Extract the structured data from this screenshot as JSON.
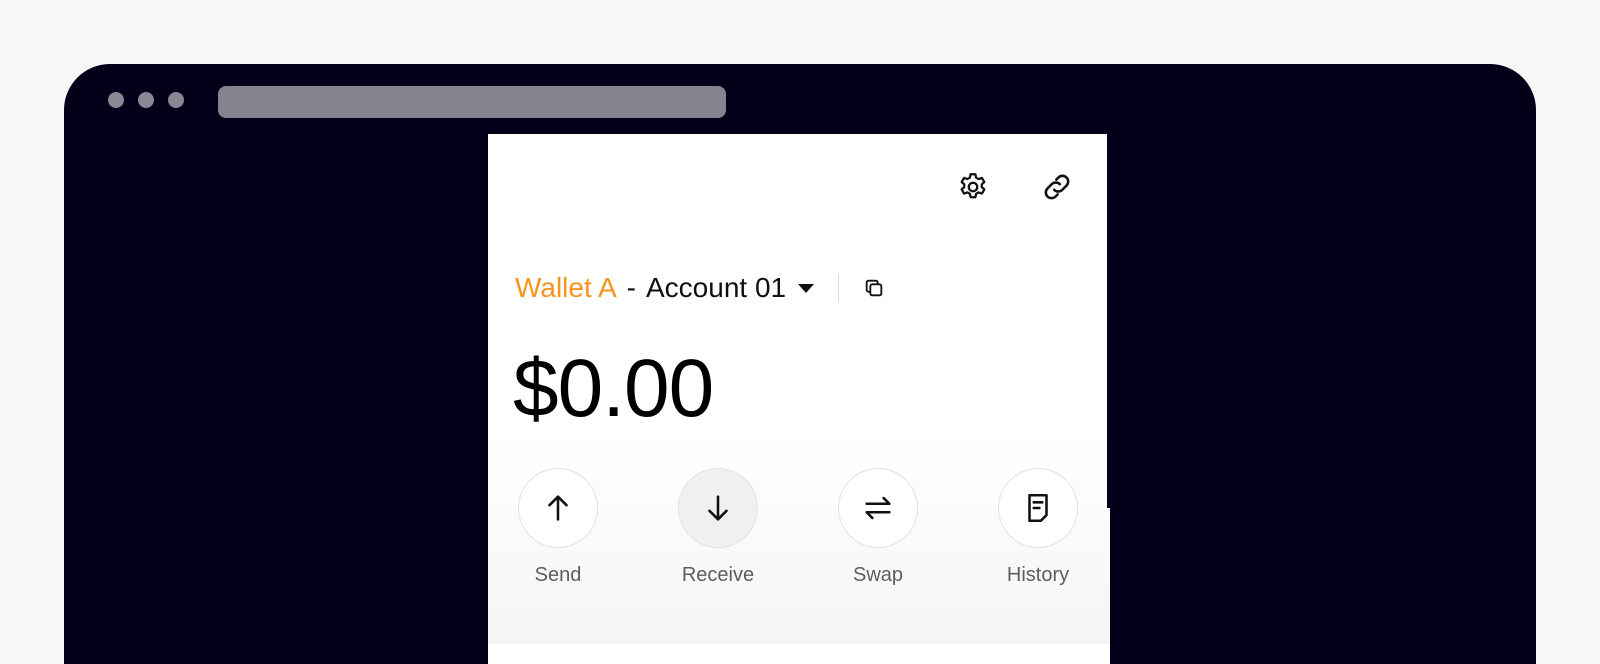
{
  "colors": {
    "background": "#f7f7f7",
    "window": "#050019",
    "accent": "#f7941d"
  },
  "header": {
    "icons": [
      "gear-icon",
      "link-icon"
    ]
  },
  "account": {
    "wallet_name": "Wallet A",
    "separator": "-",
    "account_name": "Account 01",
    "icons": [
      "chevron-down-icon",
      "copy-icon"
    ]
  },
  "balance": {
    "value": "$0.00"
  },
  "actions": [
    {
      "label": "Send",
      "icon": "arrow-up-icon"
    },
    {
      "label": "Receive",
      "icon": "arrow-down-icon"
    },
    {
      "label": "Swap",
      "icon": "swap-icon"
    },
    {
      "label": "History",
      "icon": "history-icon"
    }
  ]
}
